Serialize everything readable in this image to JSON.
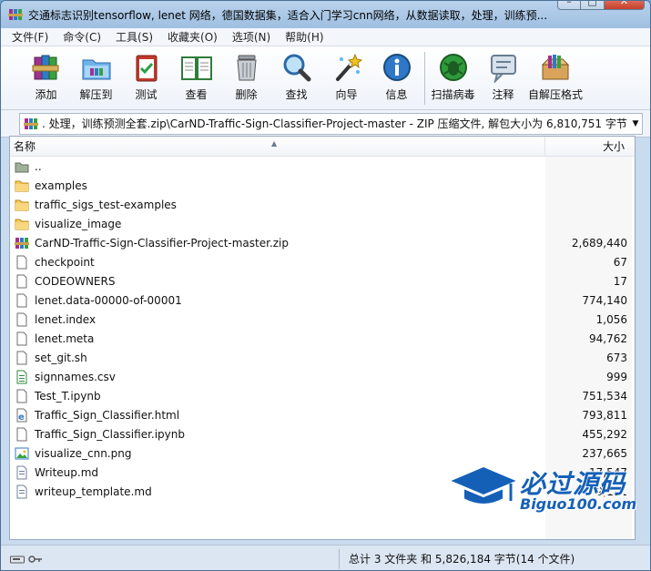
{
  "window": {
    "title": "交通标志识别tensorflow, lenet 网络，德国数据集，适合入门学习cnn网络，从数据读取，处理，训练预...",
    "buttons": {
      "minimize": "–",
      "maximize": "□",
      "close": "✕"
    }
  },
  "menu": [
    "文件(F)",
    "命令(C)",
    "工具(S)",
    "收藏夹(O)",
    "选项(N)",
    "帮助(H)"
  ],
  "toolbar": [
    {
      "label": "添加",
      "icon": "books-add-icon"
    },
    {
      "label": "解压到",
      "icon": "folder-extract-icon"
    },
    {
      "label": "测试",
      "icon": "clipboard-test-icon"
    },
    {
      "label": "查看",
      "icon": "book-view-icon"
    },
    {
      "label": "删除",
      "icon": "trash-can-icon"
    },
    {
      "label": "查找",
      "icon": "magnifier-icon"
    },
    {
      "label": "向导",
      "icon": "magic-wand-icon"
    },
    {
      "label": "信息",
      "icon": "info-icon"
    },
    {
      "label": "扫描病毒",
      "icon": "virus-scan-icon"
    },
    {
      "label": "注释",
      "icon": "comment-icon"
    },
    {
      "label": "自解压格式",
      "icon": "sfx-box-icon"
    }
  ],
  "address": {
    "path": ". 处理，训练预测全套.zip\\CarND-Traffic-Sign-Classifier-Project-master - ZIP 压缩文件, 解包大小为 6,810,751 字节"
  },
  "columns": {
    "name": "名称",
    "size": "大小"
  },
  "files": [
    {
      "name": "..",
      "size": "",
      "type": "up"
    },
    {
      "name": "examples",
      "size": "",
      "type": "folder"
    },
    {
      "name": "traffic_sigs_test-examples",
      "size": "",
      "type": "folder"
    },
    {
      "name": "visualize_image",
      "size": "",
      "type": "folder"
    },
    {
      "name": "CarND-Traffic-Sign-Classifier-Project-master.zip",
      "size": "2,689,440",
      "type": "zip"
    },
    {
      "name": "checkpoint",
      "size": "67",
      "type": "file"
    },
    {
      "name": "CODEOWNERS",
      "size": "17",
      "type": "file"
    },
    {
      "name": "lenet.data-00000-of-00001",
      "size": "774,140",
      "type": "file"
    },
    {
      "name": "lenet.index",
      "size": "1,056",
      "type": "file"
    },
    {
      "name": "lenet.meta",
      "size": "94,762",
      "type": "file"
    },
    {
      "name": "set_git.sh",
      "size": "673",
      "type": "file"
    },
    {
      "name": "signnames.csv",
      "size": "999",
      "type": "csv"
    },
    {
      "name": "Test_T.ipynb",
      "size": "751,534",
      "type": "file"
    },
    {
      "name": "Traffic_Sign_Classifier.html",
      "size": "793,811",
      "type": "html"
    },
    {
      "name": "Traffic_Sign_Classifier.ipynb",
      "size": "455,292",
      "type": "file"
    },
    {
      "name": "visualize_cnn.png",
      "size": "237,665",
      "type": "image"
    },
    {
      "name": "Writeup.md",
      "size": "17,547",
      "type": "doc"
    },
    {
      "name": "writeup_template.md",
      "size": "9,181",
      "type": "doc"
    }
  ],
  "status": {
    "summary": "总计 3 文件夹 和 5,826,184 字节(14 个文件)"
  },
  "watermark": {
    "title": "必过源码",
    "subtitle": "Biguo100.com"
  }
}
